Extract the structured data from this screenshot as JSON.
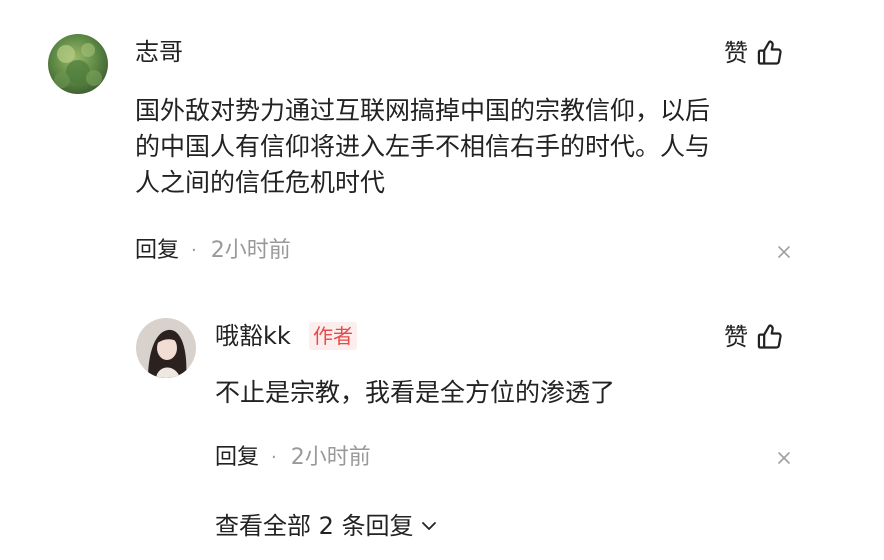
{
  "comment": {
    "username": "志哥",
    "like_label": "赞",
    "lines": [
      "国外敌对势力通过互联网搞掉中国的宗教信仰，以后",
      "的中国人有信仰将进入左手不相信右手的时代。人与",
      "人之间的信任危机时代"
    ],
    "reply_label": "回复",
    "separator": "·",
    "time": "2小时前",
    "close_icon": "close-icon"
  },
  "reply": {
    "username": "哦豁kk",
    "badge": "作者",
    "like_label": "赞",
    "text": "不止是宗教，我看是全方位的渗透了",
    "reply_label": "回复",
    "separator": "·",
    "time": "2小时前",
    "close_icon": "close-icon"
  },
  "view_all": {
    "label": "查看全部 2 条回复",
    "icon": "chevron-down-icon"
  },
  "colors": {
    "text": "#222222",
    "muted": "#999999",
    "author_badge_text": "#e8494a",
    "author_badge_bg": "#fdeeee",
    "background": "#ffffff"
  }
}
